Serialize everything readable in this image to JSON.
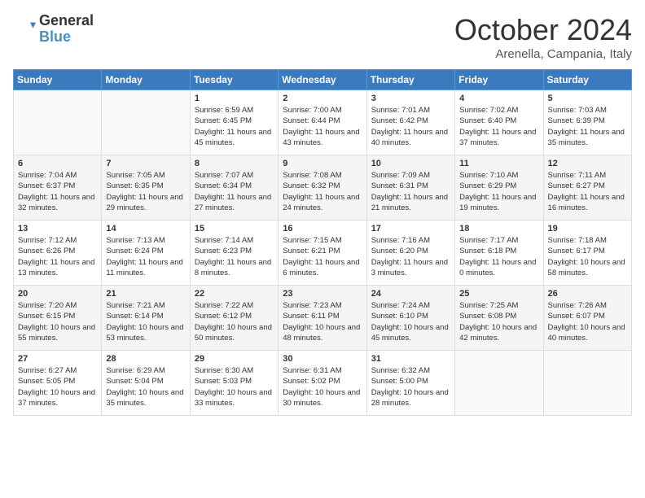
{
  "logo": {
    "line1": "General",
    "line2": "Blue"
  },
  "header": {
    "month": "October 2024",
    "location": "Arenella, Campania, Italy"
  },
  "weekdays": [
    "Sunday",
    "Monday",
    "Tuesday",
    "Wednesday",
    "Thursday",
    "Friday",
    "Saturday"
  ],
  "weeks": [
    [
      {
        "day": "",
        "content": ""
      },
      {
        "day": "",
        "content": ""
      },
      {
        "day": "1",
        "content": "Sunrise: 6:59 AM\nSunset: 6:45 PM\nDaylight: 11 hours and 45 minutes."
      },
      {
        "day": "2",
        "content": "Sunrise: 7:00 AM\nSunset: 6:44 PM\nDaylight: 11 hours and 43 minutes."
      },
      {
        "day": "3",
        "content": "Sunrise: 7:01 AM\nSunset: 6:42 PM\nDaylight: 11 hours and 40 minutes."
      },
      {
        "day": "4",
        "content": "Sunrise: 7:02 AM\nSunset: 6:40 PM\nDaylight: 11 hours and 37 minutes."
      },
      {
        "day": "5",
        "content": "Sunrise: 7:03 AM\nSunset: 6:39 PM\nDaylight: 11 hours and 35 minutes."
      }
    ],
    [
      {
        "day": "6",
        "content": "Sunrise: 7:04 AM\nSunset: 6:37 PM\nDaylight: 11 hours and 32 minutes."
      },
      {
        "day": "7",
        "content": "Sunrise: 7:05 AM\nSunset: 6:35 PM\nDaylight: 11 hours and 29 minutes."
      },
      {
        "day": "8",
        "content": "Sunrise: 7:07 AM\nSunset: 6:34 PM\nDaylight: 11 hours and 27 minutes."
      },
      {
        "day": "9",
        "content": "Sunrise: 7:08 AM\nSunset: 6:32 PM\nDaylight: 11 hours and 24 minutes."
      },
      {
        "day": "10",
        "content": "Sunrise: 7:09 AM\nSunset: 6:31 PM\nDaylight: 11 hours and 21 minutes."
      },
      {
        "day": "11",
        "content": "Sunrise: 7:10 AM\nSunset: 6:29 PM\nDaylight: 11 hours and 19 minutes."
      },
      {
        "day": "12",
        "content": "Sunrise: 7:11 AM\nSunset: 6:27 PM\nDaylight: 11 hours and 16 minutes."
      }
    ],
    [
      {
        "day": "13",
        "content": "Sunrise: 7:12 AM\nSunset: 6:26 PM\nDaylight: 11 hours and 13 minutes."
      },
      {
        "day": "14",
        "content": "Sunrise: 7:13 AM\nSunset: 6:24 PM\nDaylight: 11 hours and 11 minutes."
      },
      {
        "day": "15",
        "content": "Sunrise: 7:14 AM\nSunset: 6:23 PM\nDaylight: 11 hours and 8 minutes."
      },
      {
        "day": "16",
        "content": "Sunrise: 7:15 AM\nSunset: 6:21 PM\nDaylight: 11 hours and 6 minutes."
      },
      {
        "day": "17",
        "content": "Sunrise: 7:16 AM\nSunset: 6:20 PM\nDaylight: 11 hours and 3 minutes."
      },
      {
        "day": "18",
        "content": "Sunrise: 7:17 AM\nSunset: 6:18 PM\nDaylight: 11 hours and 0 minutes."
      },
      {
        "day": "19",
        "content": "Sunrise: 7:18 AM\nSunset: 6:17 PM\nDaylight: 10 hours and 58 minutes."
      }
    ],
    [
      {
        "day": "20",
        "content": "Sunrise: 7:20 AM\nSunset: 6:15 PM\nDaylight: 10 hours and 55 minutes."
      },
      {
        "day": "21",
        "content": "Sunrise: 7:21 AM\nSunset: 6:14 PM\nDaylight: 10 hours and 53 minutes."
      },
      {
        "day": "22",
        "content": "Sunrise: 7:22 AM\nSunset: 6:12 PM\nDaylight: 10 hours and 50 minutes."
      },
      {
        "day": "23",
        "content": "Sunrise: 7:23 AM\nSunset: 6:11 PM\nDaylight: 10 hours and 48 minutes."
      },
      {
        "day": "24",
        "content": "Sunrise: 7:24 AM\nSunset: 6:10 PM\nDaylight: 10 hours and 45 minutes."
      },
      {
        "day": "25",
        "content": "Sunrise: 7:25 AM\nSunset: 6:08 PM\nDaylight: 10 hours and 42 minutes."
      },
      {
        "day": "26",
        "content": "Sunrise: 7:26 AM\nSunset: 6:07 PM\nDaylight: 10 hours and 40 minutes."
      }
    ],
    [
      {
        "day": "27",
        "content": "Sunrise: 6:27 AM\nSunset: 5:05 PM\nDaylight: 10 hours and 37 minutes."
      },
      {
        "day": "28",
        "content": "Sunrise: 6:29 AM\nSunset: 5:04 PM\nDaylight: 10 hours and 35 minutes."
      },
      {
        "day": "29",
        "content": "Sunrise: 6:30 AM\nSunset: 5:03 PM\nDaylight: 10 hours and 33 minutes."
      },
      {
        "day": "30",
        "content": "Sunrise: 6:31 AM\nSunset: 5:02 PM\nDaylight: 10 hours and 30 minutes."
      },
      {
        "day": "31",
        "content": "Sunrise: 6:32 AM\nSunset: 5:00 PM\nDaylight: 10 hours and 28 minutes."
      },
      {
        "day": "",
        "content": ""
      },
      {
        "day": "",
        "content": ""
      }
    ]
  ]
}
